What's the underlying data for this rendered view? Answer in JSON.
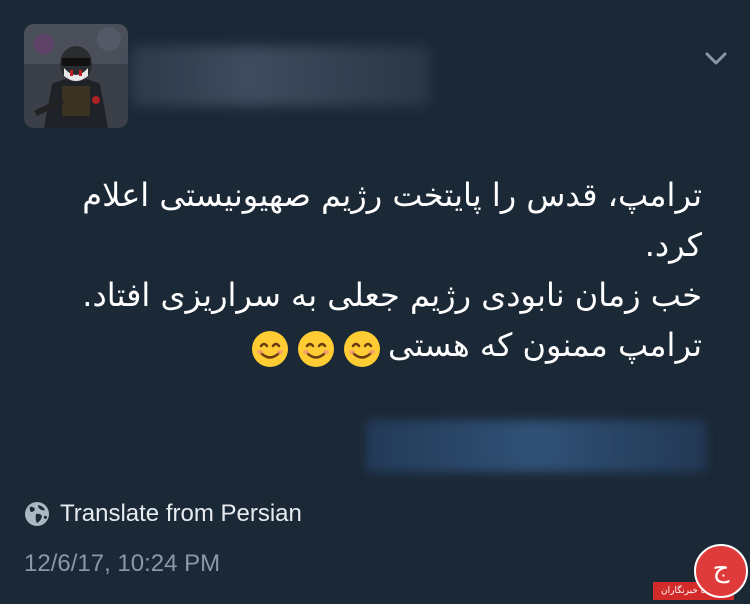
{
  "tweet": {
    "lines": [
      "ترامپ، قدس را پایتخت رژیم صهیونیستی اعلام",
      "کرد.",
      "خب زمان نابودی رژیم جعلی به سراریزی افتاد.",
      "ترامپ ممنون که هستی"
    ],
    "emojis": [
      "😊",
      "😊",
      "😊"
    ]
  },
  "translate": {
    "label": "Translate from Persian",
    "icon": "globe-icon"
  },
  "timestamp": "12/6/17, 10:24 PM",
  "header": {
    "chevron_icon": "chevron-down-icon"
  },
  "watermark": {
    "text": "باشگاه خبرنگاران",
    "logo_letter": "ج"
  },
  "colors": {
    "background": "#1b2836",
    "text": "#ffffff",
    "muted": "#8899a6",
    "watermark_red": "#d32a2a"
  }
}
